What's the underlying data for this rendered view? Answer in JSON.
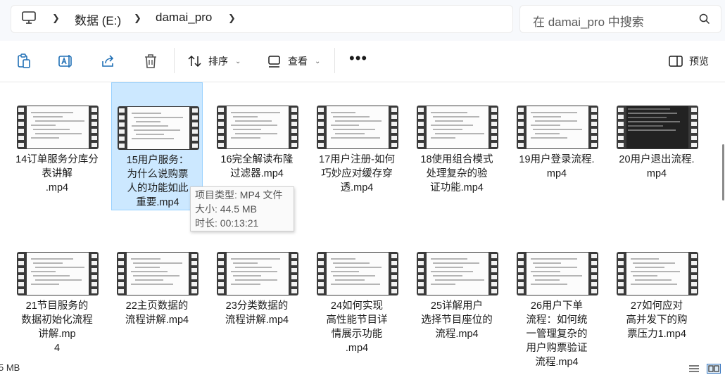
{
  "address": {
    "breadcrumb": [
      "数据 (E:)",
      "damai_pro"
    ],
    "search_placeholder": "在 damai_pro 中搜索"
  },
  "toolbar": {
    "icons": [
      "clipboard-icon",
      "rename-icon",
      "share-icon",
      "delete-icon"
    ],
    "sort_label": "排序",
    "view_label": "查看",
    "more_label": "•••",
    "preview_label": "预览"
  },
  "files": [
    {
      "name": "14订单服务分库分表讲解.mp4"
    },
    {
      "name": "15用户服务：为什么说购票人的功能如此重要.mp4",
      "selected": true
    },
    {
      "name": "16完全解读布隆过滤器.mp4"
    },
    {
      "name": "17用户注册-如何巧妙应对缓存穿透.mp4"
    },
    {
      "name": "18使用组合模式处理复杂的验证功能.mp4"
    },
    {
      "name": "19用户登录流程.mp4"
    },
    {
      "name": "20用户退出流程.mp4"
    },
    {
      "name": "21节目服务的数据初始化流程讲解.mp4"
    },
    {
      "name": "22主页数据的流程讲解.mp4"
    },
    {
      "name": "23分类数据的流程讲解.mp4"
    },
    {
      "name": "24如何实现高性能节目详情展示功能.mp4"
    },
    {
      "name": "25详解用户选择节目座位的流程.mp4"
    },
    {
      "name": "26用户下单流程：如何统一管理复杂的用户购票验证流程.mp4"
    },
    {
      "name": "27如何应对高并发下的购票压力1.mp4"
    }
  ],
  "tooltip": {
    "type": "项目类型: MP4 文件",
    "size": "大小: 44.5 MB",
    "duration": "时长: 00:13:21"
  },
  "status": {
    "text": "5 MB"
  },
  "colors": {
    "selection_bg": "#cce8ff",
    "selection_border": "#99d1ff",
    "addressbar_bg": "#f7f9fc"
  }
}
